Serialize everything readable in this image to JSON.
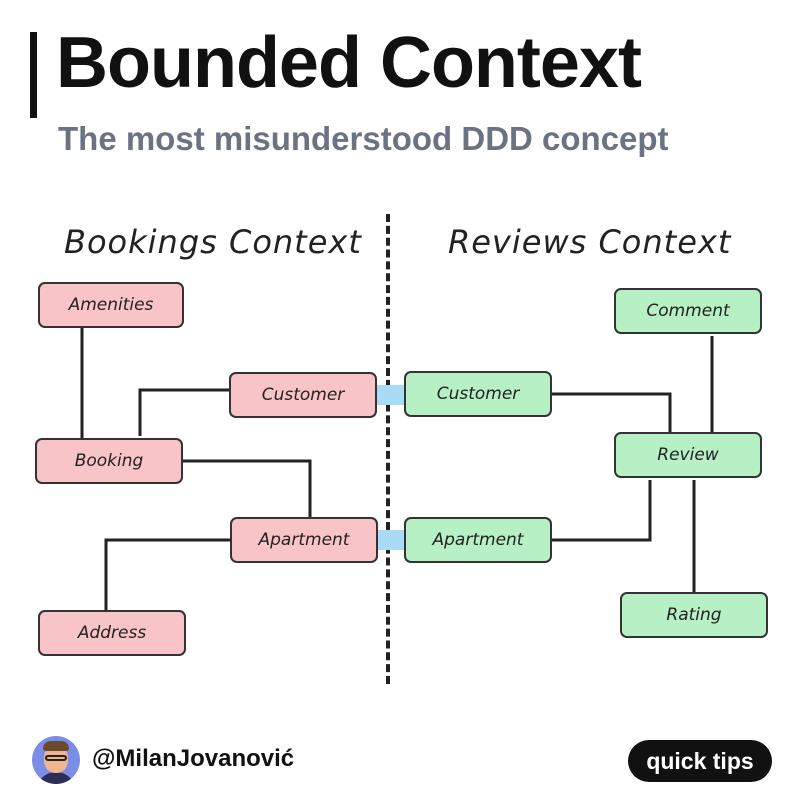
{
  "header": {
    "title": "Bounded Context",
    "subtitle": "The most misunderstood DDD concept"
  },
  "contexts": {
    "bookings": {
      "label": "Bookings Context",
      "color": "#f9c4c8",
      "entities": {
        "amenities": "Amenities",
        "customer": "Customer",
        "booking": "Booking",
        "apartment": "Apartment",
        "address": "Address"
      }
    },
    "reviews": {
      "label": "Reviews Context",
      "color": "#b7f0c4",
      "entities": {
        "comment": "Comment",
        "customer": "Customer",
        "review": "Review",
        "apartment": "Apartment",
        "rating": "Rating"
      }
    }
  },
  "shared_link_color": "#a9daf6",
  "footer": {
    "handle": "@MilanJovanović",
    "badge": "quick tips",
    "avatar_icon": "profile-photo"
  }
}
